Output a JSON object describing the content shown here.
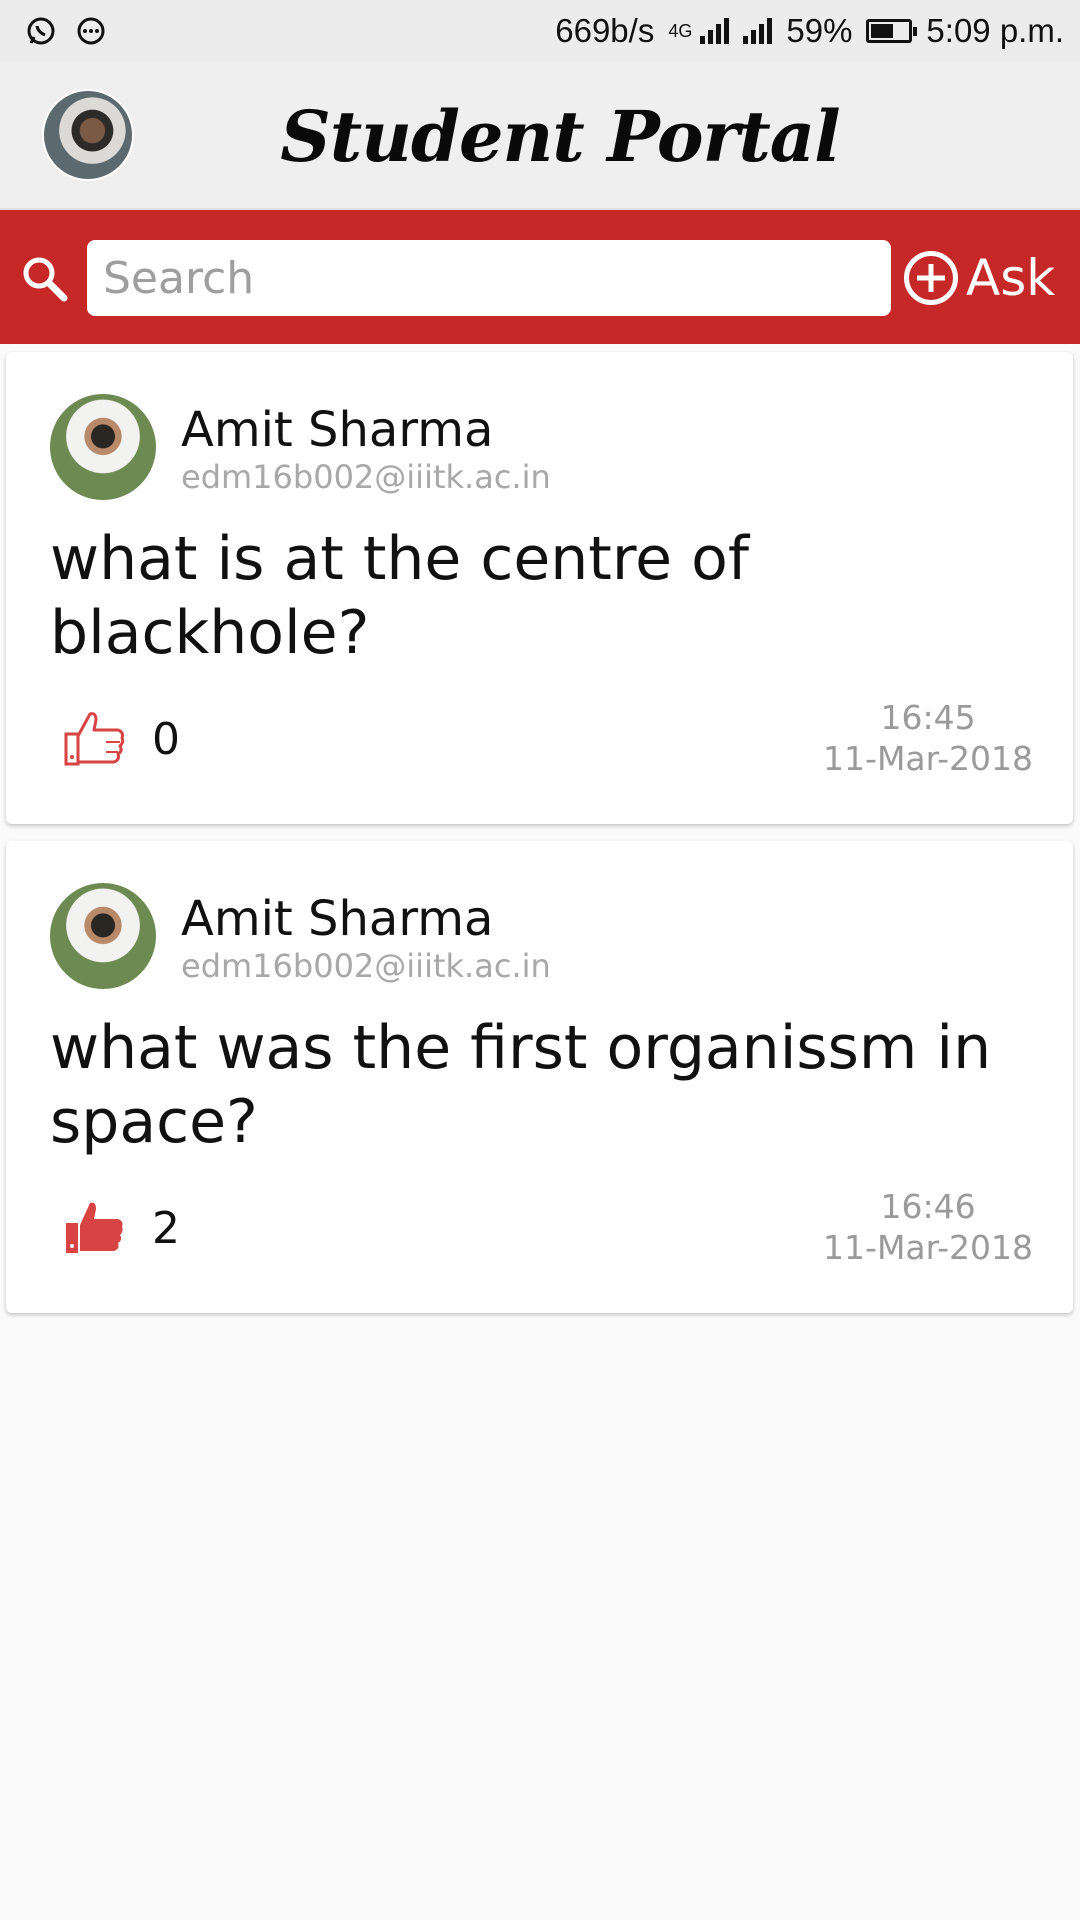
{
  "status_bar": {
    "speed": "669b/s",
    "network": "4G",
    "battery": "59%",
    "battery_level": 0.59,
    "time": "5:09 p.m.",
    "icons": [
      "whatsapp-icon",
      "chat-bubble-icon",
      "signal-icon",
      "battery-icon"
    ]
  },
  "app_bar": {
    "title": "Student Portal",
    "avatar": "profile-avatar"
  },
  "search": {
    "placeholder": "Search",
    "value": "",
    "ask_label": "Ask"
  },
  "colors": {
    "primary": "#c62828",
    "like": "#d84343"
  },
  "posts": [
    {
      "author": "Amit Sharma",
      "email": "edm16b002@iiitk.ac.in",
      "question": "what is at the centre of blackhole?",
      "likes": "0",
      "liked": false,
      "time": "16:45",
      "date": "11-Mar-2018"
    },
    {
      "author": "Amit Sharma",
      "email": "edm16b002@iiitk.ac.in",
      "question": "what was the first organissm in space?",
      "likes": "2",
      "liked": true,
      "time": "16:46",
      "date": "11-Mar-2018"
    }
  ]
}
